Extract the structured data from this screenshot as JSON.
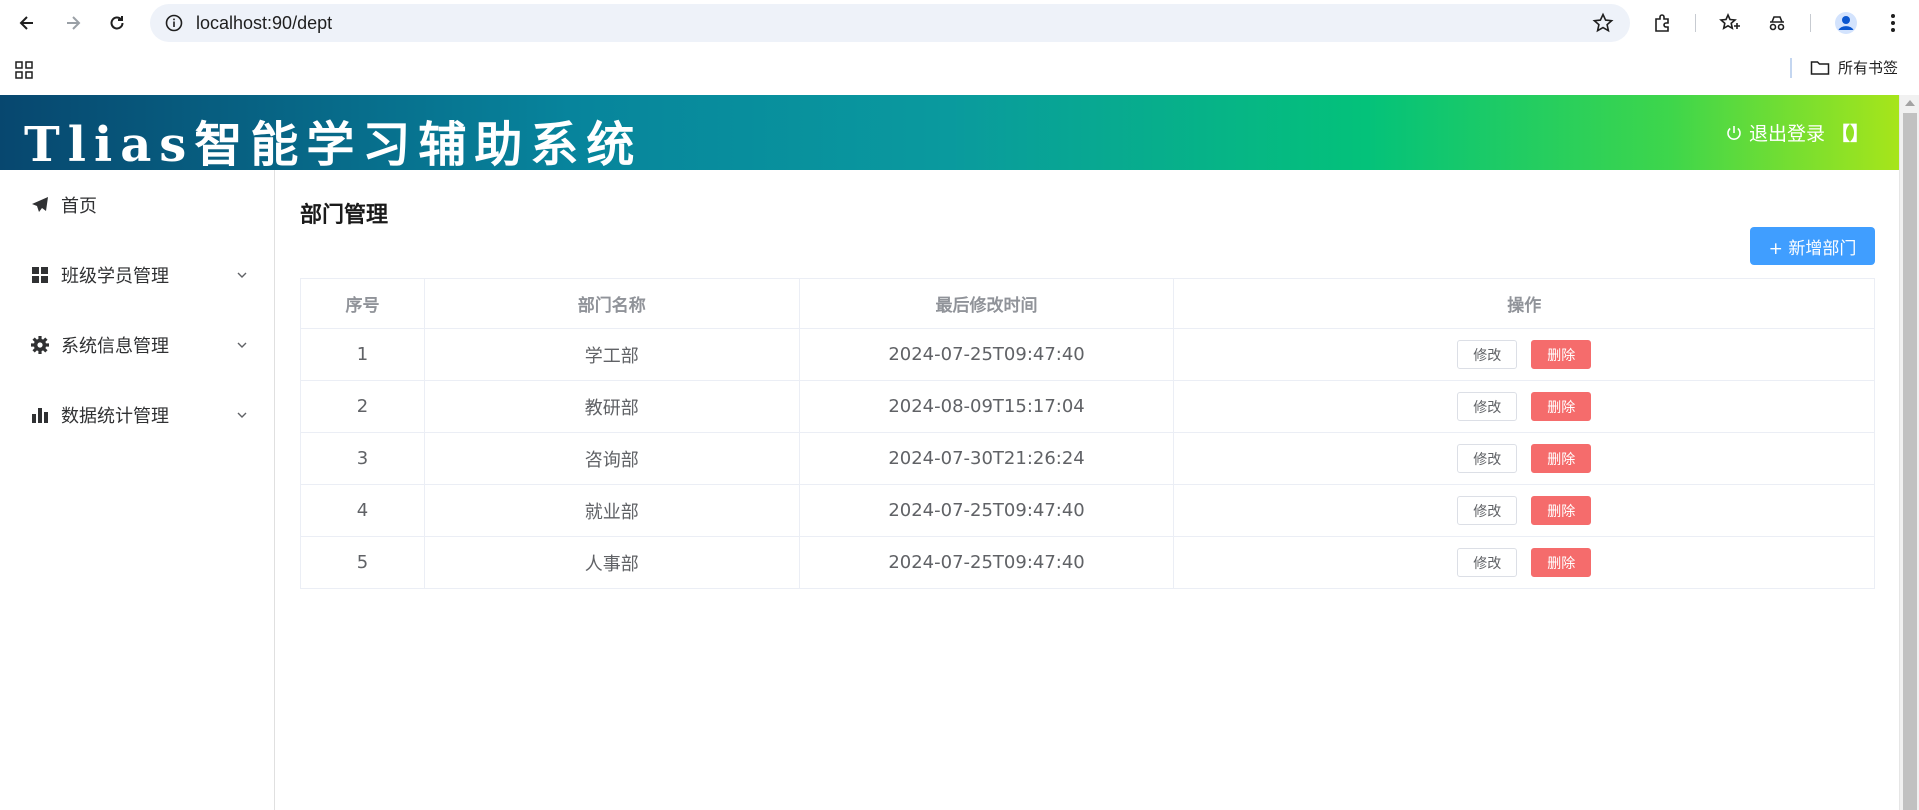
{
  "browser": {
    "url": "localhost:90/dept",
    "bookmark_folder": "所有书签"
  },
  "app": {
    "title": "Tlias智能学习辅助系统",
    "logout_label": "退出登录",
    "logout_suffix": "【】"
  },
  "sidebar": {
    "items": [
      {
        "label": "首页",
        "icon": "paper-plane-icon",
        "expandable": false
      },
      {
        "label": "班级学员管理",
        "icon": "grid-icon",
        "expandable": true
      },
      {
        "label": "系统信息管理",
        "icon": "gear-icon",
        "expandable": true
      },
      {
        "label": "数据统计管理",
        "icon": "bar-chart-icon",
        "expandable": true
      }
    ]
  },
  "main": {
    "page_title": "部门管理",
    "add_button": "+ 新增部门",
    "table": {
      "headers": [
        "序号",
        "部门名称",
        "最后修改时间",
        "操作"
      ],
      "rows": [
        {
          "index": "1",
          "name": "学工部",
          "updated": "2024-07-25T09:47:40"
        },
        {
          "index": "2",
          "name": "教研部",
          "updated": "2024-08-09T15:17:04"
        },
        {
          "index": "3",
          "name": "咨询部",
          "updated": "2024-07-30T21:26:24"
        },
        {
          "index": "4",
          "name": "就业部",
          "updated": "2024-07-25T09:47:40"
        },
        {
          "index": "5",
          "name": "人事部",
          "updated": "2024-07-25T09:47:40"
        }
      ],
      "edit_label": "修改",
      "delete_label": "删除"
    }
  },
  "colors": {
    "primary": "#409eff",
    "danger": "#f56c6c"
  }
}
